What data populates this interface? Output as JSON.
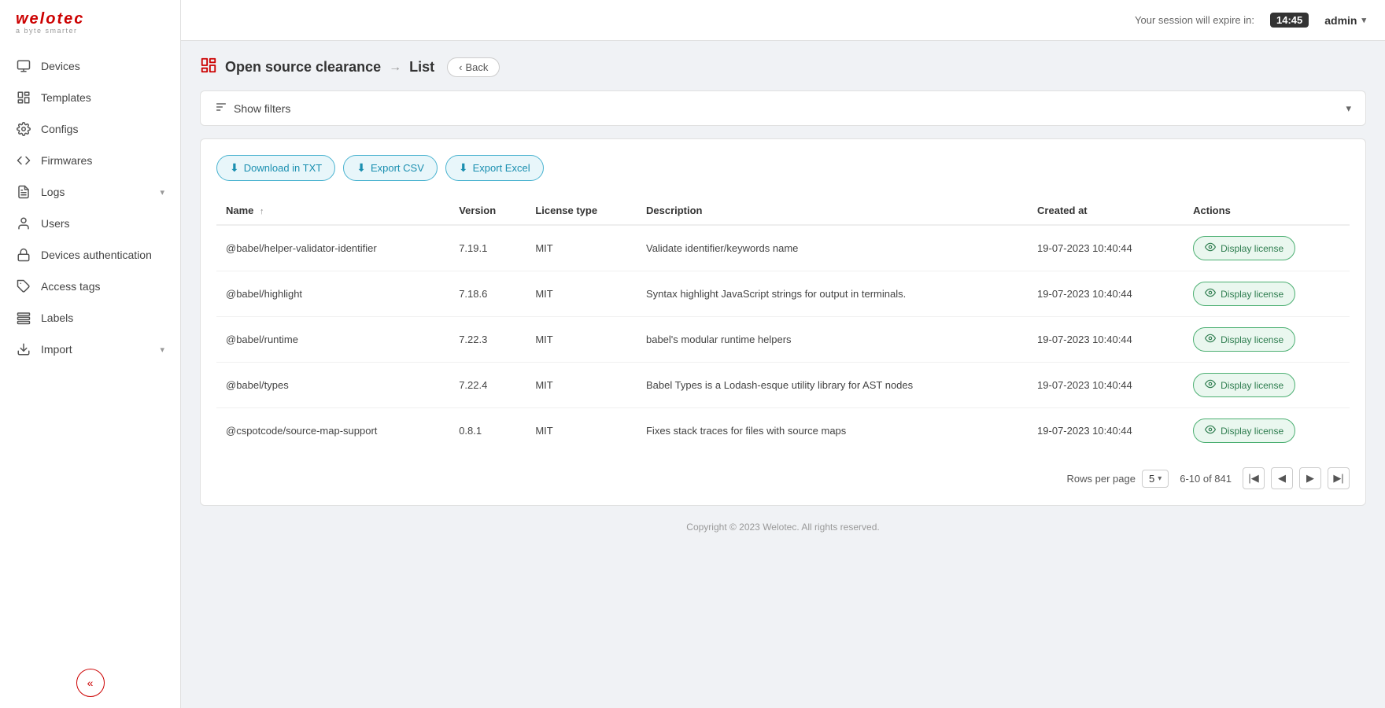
{
  "brand": {
    "name": "welotec",
    "tagline": "a byte smarter"
  },
  "topbar": {
    "session_label": "Your session will expire in:",
    "session_time": "14:45",
    "user": "admin"
  },
  "sidebar": {
    "items": [
      {
        "id": "devices",
        "label": "Devices",
        "icon": "devices",
        "hasChevron": false
      },
      {
        "id": "templates",
        "label": "Templates",
        "icon": "templates",
        "hasChevron": false
      },
      {
        "id": "configs",
        "label": "Configs",
        "icon": "configs",
        "hasChevron": false
      },
      {
        "id": "firmwares",
        "label": "Firmwares",
        "icon": "firmwares",
        "hasChevron": false
      },
      {
        "id": "logs",
        "label": "Logs",
        "icon": "logs",
        "hasChevron": true
      },
      {
        "id": "users",
        "label": "Users",
        "icon": "users",
        "hasChevron": false
      },
      {
        "id": "devices-auth",
        "label": "Devices authentication",
        "icon": "devicesauth",
        "hasChevron": false
      },
      {
        "id": "access-tags",
        "label": "Access tags",
        "icon": "accesstags",
        "hasChevron": false
      },
      {
        "id": "labels",
        "label": "Labels",
        "icon": "labels",
        "hasChevron": false
      },
      {
        "id": "import",
        "label": "Import",
        "icon": "import",
        "hasChevron": true
      }
    ],
    "collapse_label": "«"
  },
  "breadcrumb": {
    "title": "Open source clearance",
    "separator": "→",
    "current": "List",
    "back_label": "Back"
  },
  "filter": {
    "label": "Show filters"
  },
  "table": {
    "buttons": [
      {
        "id": "download-txt",
        "label": "Download in TXT"
      },
      {
        "id": "export-csv",
        "label": "Export CSV"
      },
      {
        "id": "export-excel",
        "label": "Export Excel"
      }
    ],
    "columns": [
      {
        "id": "name",
        "label": "Name",
        "sortable": true
      },
      {
        "id": "version",
        "label": "Version"
      },
      {
        "id": "license-type",
        "label": "License type"
      },
      {
        "id": "description",
        "label": "Description"
      },
      {
        "id": "created-at",
        "label": "Created at"
      },
      {
        "id": "actions",
        "label": "Actions"
      }
    ],
    "rows": [
      {
        "name": "@babel/helper-validator-identifier",
        "version": "7.19.1",
        "license": "MIT",
        "description": "Validate identifier/keywords name",
        "created": "19-07-2023 10:40:44"
      },
      {
        "name": "@babel/highlight",
        "version": "7.18.6",
        "license": "MIT",
        "description": "Syntax highlight JavaScript strings for output in terminals.",
        "created": "19-07-2023 10:40:44"
      },
      {
        "name": "@babel/runtime",
        "version": "7.22.3",
        "license": "MIT",
        "description": "babel's modular runtime helpers",
        "created": "19-07-2023 10:40:44"
      },
      {
        "name": "@babel/types",
        "version": "7.22.4",
        "license": "MIT",
        "description": "Babel Types is a Lodash-esque utility library for AST nodes",
        "created": "19-07-2023 10:40:44"
      },
      {
        "name": "@cspotcode/source-map-support",
        "version": "0.8.1",
        "license": "MIT",
        "description": "Fixes stack traces for files with source maps",
        "created": "19-07-2023 10:40:44"
      }
    ],
    "display_license_label": "Display license",
    "pagination": {
      "rows_per_page_label": "Rows per page",
      "rows_per_page_value": "5",
      "page_info": "6-10 of 841"
    }
  },
  "footer": {
    "text": "Copyright © 2023 Welotec. All rights reserved."
  }
}
